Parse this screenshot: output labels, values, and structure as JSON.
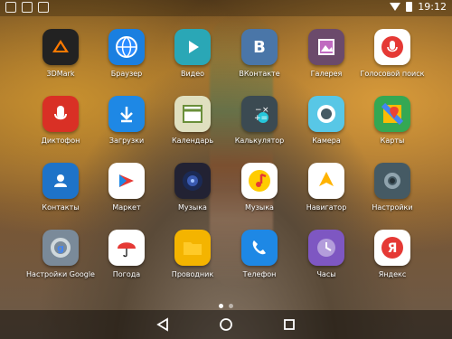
{
  "status_bar": {
    "time": "19:12"
  },
  "apps": [
    {
      "label": "3DMark",
      "icon": "3dmark-icon",
      "bg": "#222222"
    },
    {
      "label": "Браузер",
      "icon": "browser-globe-icon",
      "bg": "#1a7fe0"
    },
    {
      "label": "Видео",
      "icon": "video-play-icon",
      "bg": "#2aa7b6"
    },
    {
      "label": "ВКонтакте",
      "icon": "vk-icon",
      "bg": "#4a76a8"
    },
    {
      "label": "Галерея",
      "icon": "gallery-icon",
      "bg": "#6b4a6b"
    },
    {
      "label": "Голосовой поиск",
      "icon": "microphone-icon",
      "bg": "#ffffff"
    },
    {
      "label": "Диктофон",
      "icon": "recorder-icon",
      "bg": "#d93025"
    },
    {
      "label": "Загрузки",
      "icon": "download-icon",
      "bg": "#1e88e5"
    },
    {
      "label": "Календарь",
      "icon": "calendar-icon",
      "bg": "#e0e0c0"
    },
    {
      "label": "Калькулятор",
      "icon": "calculator-icon",
      "bg": "#3b4a52"
    },
    {
      "label": "Камера",
      "icon": "camera-icon",
      "bg": "#58c7e6"
    },
    {
      "label": "Карты",
      "icon": "maps-icon",
      "bg": "#34a853"
    },
    {
      "label": "Контакты",
      "icon": "contacts-icon",
      "bg": "#1e73c8"
    },
    {
      "label": "Маркет",
      "icon": "market-icon",
      "bg": "#ffffff"
    },
    {
      "label": "Музыка",
      "icon": "speaker-icon",
      "bg": "#222233"
    },
    {
      "label": "Музыка",
      "icon": "music-note-icon",
      "bg": "#ffffff"
    },
    {
      "label": "Навигатор",
      "icon": "navigator-icon",
      "bg": "#ffffff"
    },
    {
      "label": "Настройки",
      "icon": "settings-gear-icon",
      "bg": "#455a64"
    },
    {
      "label": "Настройки Google",
      "icon": "google-settings-icon",
      "bg": "#7a8a99"
    },
    {
      "label": "Погода",
      "icon": "weather-umbrella-icon",
      "bg": "#ffffff"
    },
    {
      "label": "Проводник",
      "icon": "folder-icon",
      "bg": "#f4b400"
    },
    {
      "label": "Телефон",
      "icon": "phone-icon",
      "bg": "#1e88e5"
    },
    {
      "label": "Часы",
      "icon": "clock-icon",
      "bg": "#7e57c2"
    },
    {
      "label": "Яндекс",
      "icon": "yandex-icon",
      "bg": "#ffffff"
    }
  ],
  "page_indicator": {
    "pages": 2,
    "current": 1
  },
  "navbar": {
    "back": "back-triangle-icon",
    "home": "home-circle-icon",
    "recents": "recents-square-icon"
  }
}
